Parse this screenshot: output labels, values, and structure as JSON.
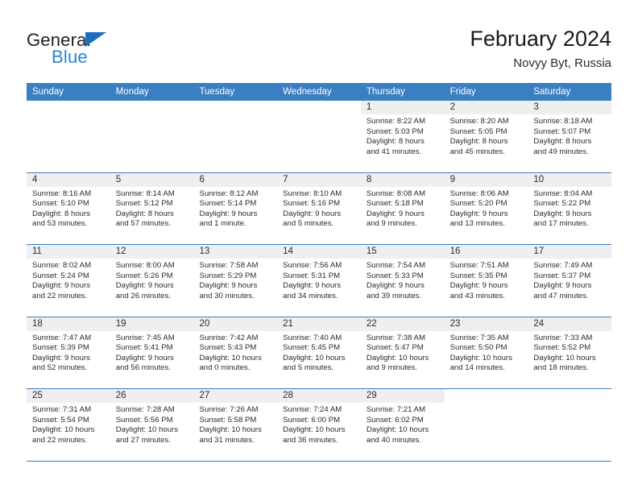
{
  "brand": {
    "name_top": "General",
    "name_bottom": "Blue",
    "triangle_color": "#1f6fc0",
    "top_color": "#231f20",
    "bottom_color": "#2585d3"
  },
  "header": {
    "title": "February 2024",
    "subtitle": "Novyy Byt, Russia",
    "accent_color": "#3a7fc1"
  },
  "weekdays": [
    "Sunday",
    "Monday",
    "Tuesday",
    "Wednesday",
    "Thursday",
    "Friday",
    "Saturday"
  ],
  "weeks": [
    [
      {
        "day": "",
        "lines": []
      },
      {
        "day": "",
        "lines": []
      },
      {
        "day": "",
        "lines": []
      },
      {
        "day": "",
        "lines": []
      },
      {
        "day": "1",
        "lines": [
          "Sunrise: 8:22 AM",
          "Sunset: 5:03 PM",
          "Daylight: 8 hours",
          "and 41 minutes."
        ]
      },
      {
        "day": "2",
        "lines": [
          "Sunrise: 8:20 AM",
          "Sunset: 5:05 PM",
          "Daylight: 8 hours",
          "and 45 minutes."
        ]
      },
      {
        "day": "3",
        "lines": [
          "Sunrise: 8:18 AM",
          "Sunset: 5:07 PM",
          "Daylight: 8 hours",
          "and 49 minutes."
        ]
      }
    ],
    [
      {
        "day": "4",
        "lines": [
          "Sunrise: 8:16 AM",
          "Sunset: 5:10 PM",
          "Daylight: 8 hours",
          "and 53 minutes."
        ]
      },
      {
        "day": "5",
        "lines": [
          "Sunrise: 8:14 AM",
          "Sunset: 5:12 PM",
          "Daylight: 8 hours",
          "and 57 minutes."
        ]
      },
      {
        "day": "6",
        "lines": [
          "Sunrise: 8:12 AM",
          "Sunset: 5:14 PM",
          "Daylight: 9 hours",
          "and 1 minute."
        ]
      },
      {
        "day": "7",
        "lines": [
          "Sunrise: 8:10 AM",
          "Sunset: 5:16 PM",
          "Daylight: 9 hours",
          "and 5 minutes."
        ]
      },
      {
        "day": "8",
        "lines": [
          "Sunrise: 8:08 AM",
          "Sunset: 5:18 PM",
          "Daylight: 9 hours",
          "and 9 minutes."
        ]
      },
      {
        "day": "9",
        "lines": [
          "Sunrise: 8:06 AM",
          "Sunset: 5:20 PM",
          "Daylight: 9 hours",
          "and 13 minutes."
        ]
      },
      {
        "day": "10",
        "lines": [
          "Sunrise: 8:04 AM",
          "Sunset: 5:22 PM",
          "Daylight: 9 hours",
          "and 17 minutes."
        ]
      }
    ],
    [
      {
        "day": "11",
        "lines": [
          "Sunrise: 8:02 AM",
          "Sunset: 5:24 PM",
          "Daylight: 9 hours",
          "and 22 minutes."
        ]
      },
      {
        "day": "12",
        "lines": [
          "Sunrise: 8:00 AM",
          "Sunset: 5:26 PM",
          "Daylight: 9 hours",
          "and 26 minutes."
        ]
      },
      {
        "day": "13",
        "lines": [
          "Sunrise: 7:58 AM",
          "Sunset: 5:29 PM",
          "Daylight: 9 hours",
          "and 30 minutes."
        ]
      },
      {
        "day": "14",
        "lines": [
          "Sunrise: 7:56 AM",
          "Sunset: 5:31 PM",
          "Daylight: 9 hours",
          "and 34 minutes."
        ]
      },
      {
        "day": "15",
        "lines": [
          "Sunrise: 7:54 AM",
          "Sunset: 5:33 PM",
          "Daylight: 9 hours",
          "and 39 minutes."
        ]
      },
      {
        "day": "16",
        "lines": [
          "Sunrise: 7:51 AM",
          "Sunset: 5:35 PM",
          "Daylight: 9 hours",
          "and 43 minutes."
        ]
      },
      {
        "day": "17",
        "lines": [
          "Sunrise: 7:49 AM",
          "Sunset: 5:37 PM",
          "Daylight: 9 hours",
          "and 47 minutes."
        ]
      }
    ],
    [
      {
        "day": "18",
        "lines": [
          "Sunrise: 7:47 AM",
          "Sunset: 5:39 PM",
          "Daylight: 9 hours",
          "and 52 minutes."
        ]
      },
      {
        "day": "19",
        "lines": [
          "Sunrise: 7:45 AM",
          "Sunset: 5:41 PM",
          "Daylight: 9 hours",
          "and 56 minutes."
        ]
      },
      {
        "day": "20",
        "lines": [
          "Sunrise: 7:42 AM",
          "Sunset: 5:43 PM",
          "Daylight: 10 hours",
          "and 0 minutes."
        ]
      },
      {
        "day": "21",
        "lines": [
          "Sunrise: 7:40 AM",
          "Sunset: 5:45 PM",
          "Daylight: 10 hours",
          "and 5 minutes."
        ]
      },
      {
        "day": "22",
        "lines": [
          "Sunrise: 7:38 AM",
          "Sunset: 5:47 PM",
          "Daylight: 10 hours",
          "and 9 minutes."
        ]
      },
      {
        "day": "23",
        "lines": [
          "Sunrise: 7:35 AM",
          "Sunset: 5:50 PM",
          "Daylight: 10 hours",
          "and 14 minutes."
        ]
      },
      {
        "day": "24",
        "lines": [
          "Sunrise: 7:33 AM",
          "Sunset: 5:52 PM",
          "Daylight: 10 hours",
          "and 18 minutes."
        ]
      }
    ],
    [
      {
        "day": "25",
        "lines": [
          "Sunrise: 7:31 AM",
          "Sunset: 5:54 PM",
          "Daylight: 10 hours",
          "and 22 minutes."
        ]
      },
      {
        "day": "26",
        "lines": [
          "Sunrise: 7:28 AM",
          "Sunset: 5:56 PM",
          "Daylight: 10 hours",
          "and 27 minutes."
        ]
      },
      {
        "day": "27",
        "lines": [
          "Sunrise: 7:26 AM",
          "Sunset: 5:58 PM",
          "Daylight: 10 hours",
          "and 31 minutes."
        ]
      },
      {
        "day": "28",
        "lines": [
          "Sunrise: 7:24 AM",
          "Sunset: 6:00 PM",
          "Daylight: 10 hours",
          "and 36 minutes."
        ]
      },
      {
        "day": "29",
        "lines": [
          "Sunrise: 7:21 AM",
          "Sunset: 6:02 PM",
          "Daylight: 10 hours",
          "and 40 minutes."
        ]
      },
      {
        "day": "",
        "lines": []
      },
      {
        "day": "",
        "lines": []
      }
    ]
  ]
}
